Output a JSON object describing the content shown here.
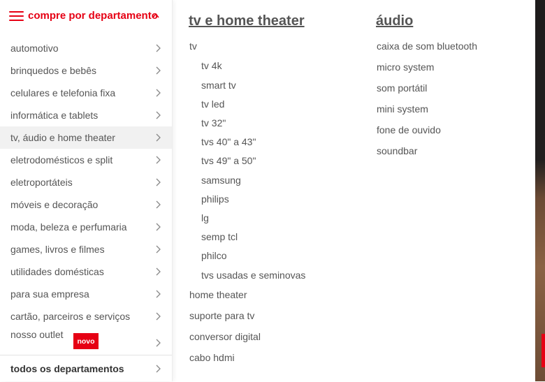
{
  "sidebar": {
    "header_label": "compre por departamento",
    "items": [
      {
        "label": "automotivo"
      },
      {
        "label": "brinquedos e bebês"
      },
      {
        "label": "celulares e telefonia fixa"
      },
      {
        "label": "informática e tablets"
      },
      {
        "label": "tv, áudio e home theater",
        "active": true
      },
      {
        "label": "eletrodomésticos e split"
      },
      {
        "label": "eletroportáteis"
      },
      {
        "label": "móveis e decoração"
      },
      {
        "label": "moda, beleza e perfumaria"
      },
      {
        "label": "games, livros e filmes"
      },
      {
        "label": "utilidades domésticas"
      },
      {
        "label": "para sua empresa"
      },
      {
        "label": "cartão, parceiros e serviços"
      },
      {
        "label": "nosso outlet",
        "badge": "novo"
      }
    ],
    "all_departments_label": "todos os departamentos"
  },
  "submenu": {
    "tv_column": {
      "title": "tv e home theater",
      "links": [
        {
          "label": "tv",
          "level": 0
        },
        {
          "label": "tv 4k",
          "level": 1
        },
        {
          "label": "smart tv",
          "level": 1
        },
        {
          "label": "tv led",
          "level": 1
        },
        {
          "label": "tv 32\"",
          "level": 1
        },
        {
          "label": "tvs 40\" a 43\"",
          "level": 1
        },
        {
          "label": "tvs 49\" a 50\"",
          "level": 1
        },
        {
          "label": "samsung",
          "level": 1
        },
        {
          "label": "philips",
          "level": 1
        },
        {
          "label": "lg",
          "level": 1
        },
        {
          "label": "semp tcl",
          "level": 1
        },
        {
          "label": "philco",
          "level": 1
        },
        {
          "label": "tvs usadas e seminovas",
          "level": 1
        },
        {
          "label": "home theater",
          "level": 0
        },
        {
          "label": "suporte para tv",
          "level": 0
        },
        {
          "label": "conversor digital",
          "level": 0
        },
        {
          "label": "cabo hdmi",
          "level": 0
        }
      ]
    },
    "audio_column": {
      "title": "áudio",
      "links": [
        {
          "label": "caixa de som bluetooth"
        },
        {
          "label": "micro system"
        },
        {
          "label": "som portátil"
        },
        {
          "label": "mini system"
        },
        {
          "label": "fone de ouvido"
        },
        {
          "label": "soundbar"
        }
      ]
    }
  },
  "colors": {
    "brand_red": "#e60014",
    "text": "#555555",
    "active_bg": "#f1f1f1"
  }
}
